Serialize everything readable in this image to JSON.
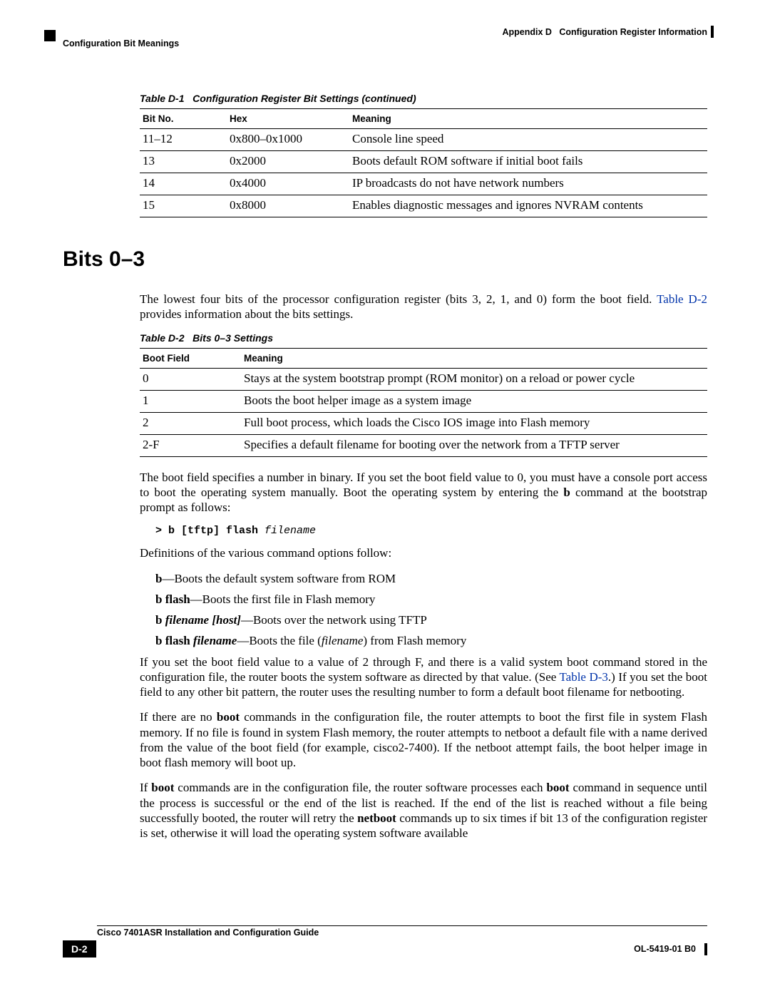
{
  "header": {
    "appendix": "Appendix D",
    "chapter": "Configuration Register Information",
    "section": "Configuration Bit Meanings"
  },
  "table1": {
    "caption_num": "Table D-1",
    "caption_title": "Configuration Register Bit Settings (continued)",
    "h1": "Bit No.",
    "h2": "Hex",
    "h3": "Meaning",
    "rows": [
      {
        "c1": "11–12",
        "c2": "0x800–0x1000",
        "c3": "Console line speed"
      },
      {
        "c1": "13",
        "c2": "0x2000",
        "c3": "Boots default ROM software if initial boot fails"
      },
      {
        "c1": "14",
        "c2": "0x4000",
        "c3": "IP broadcasts do not have network numbers"
      },
      {
        "c1": "15",
        "c2": "0x8000",
        "c3": "Enables diagnostic messages and ignores NVRAM contents"
      }
    ]
  },
  "heading": "Bits 0–3",
  "para1a": "The lowest four bits of the processor configuration register (bits 3, 2, 1, and 0) form the boot field. ",
  "para1_link": "Table D-2",
  "para1b": " provides information about the bits settings.",
  "table2": {
    "caption_num": "Table D-2",
    "caption_title": "Bits 0–3 Settings",
    "h1": "Boot Field",
    "h2": "Meaning",
    "rows": [
      {
        "c1": "0",
        "c2": "Stays at the system bootstrap prompt (ROM monitor) on a reload or power cycle"
      },
      {
        "c1": "1",
        "c2": "Boots the boot helper image as a system image"
      },
      {
        "c1": "2",
        "c2": "Full boot process, which loads the Cisco IOS image into Flash memory"
      },
      {
        "c1": "2-F",
        "c2": "Specifies a default filename for booting over the network from a TFTP server"
      }
    ]
  },
  "para2a": "The boot field specifies a number in binary. If you set the boot field value to 0, you must have a console port access to boot the operating system manually. Boot the operating system by entering the ",
  "para2b": "b",
  "para2c": " command at the bootstrap prompt as follows:",
  "code": {
    "prefix": "> b [tftp] flash ",
    "arg": "filename"
  },
  "para3": "Definitions of the various command options follow:",
  "defs": {
    "d1a": "b",
    "d1b": "—Boots the default system software from ROM",
    "d2a": "b flash",
    "d2b": "—Boots the first file in Flash memory",
    "d3a": "b ",
    "d3i": "filename [host]",
    "d3b": "—Boots over the network using TFTP",
    "d4a": "b flash ",
    "d4i": "filename",
    "d4b": "—Boots the file (",
    "d4i2": "filename",
    "d4c": ") from Flash memory"
  },
  "para4a": "If you set the boot field value to a value of 2 through F, and there is a valid system boot command stored in the configuration file, the router boots the system software as directed by that value. (See ",
  "para4_link": "Table D-3",
  "para4b": ".) If you set the boot field to any other bit pattern, the router uses the resulting number to form a default boot filename for netbooting.",
  "para5a": "If there are no ",
  "para5b": "boot",
  "para5c": " commands in the configuration file, the router attempts to boot the first file in system Flash memory. If no file is found in system Flash memory, the router attempts to netboot a default file with a name derived from the value of the boot field (for example, cisco2-7400). If the netboot attempt fails, the boot helper image in boot flash memory will boot up.",
  "para6a": "If ",
  "para6b": "boot",
  "para6c": " commands are in the configuration file, the router software processes each ",
  "para6d": "boot",
  "para6e": " command in sequence until the process is successful or the end of the list is reached. If the end of the list is reached without a file being successfully booted, the router will retry the ",
  "para6f": "netboot",
  "para6g": " commands up to six times if bit 13 of the configuration register is set, otherwise it will load the operating system software available",
  "footer": {
    "title": "Cisco 7401ASR Installation and Configuration Guide",
    "page": "D-2",
    "docnum": "OL-5419-01 B0"
  }
}
